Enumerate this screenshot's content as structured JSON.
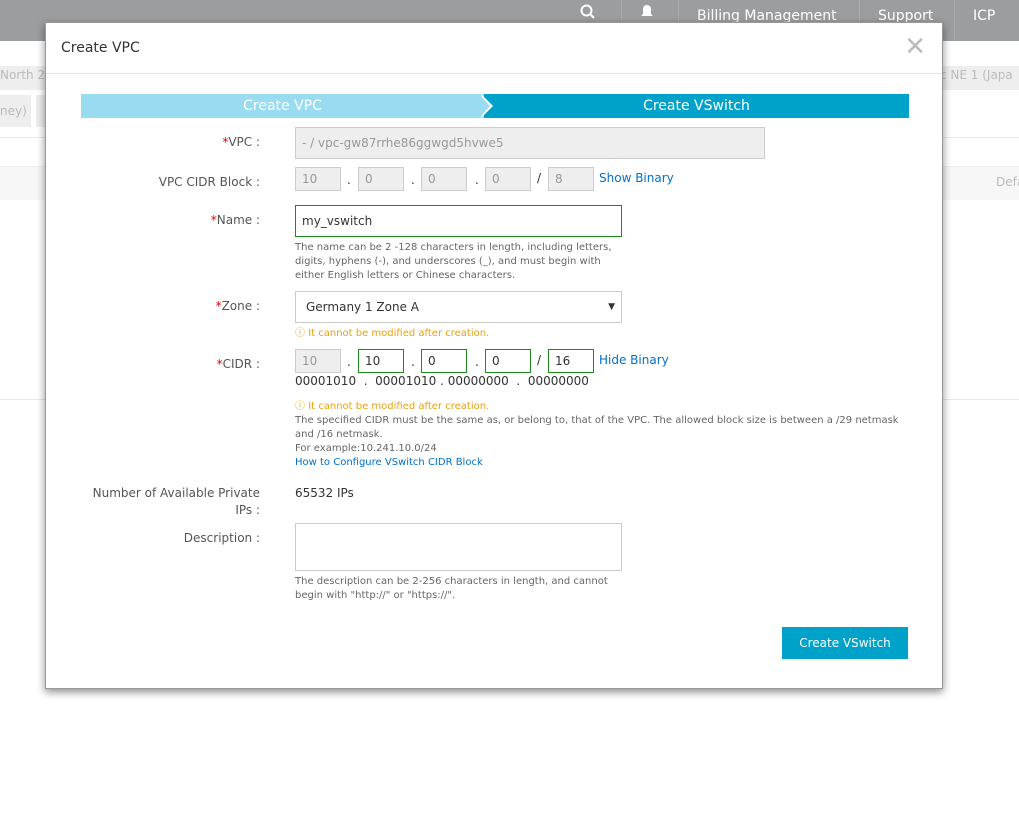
{
  "topbar": {
    "billing": "Billing Management",
    "support": "Support",
    "icp": "ICP"
  },
  "background": {
    "region_left": "North 2 (",
    "region_right": "c NE 1 (Japa",
    "tab_left": "ney)",
    "col_right": "Defa"
  },
  "modal": {
    "title": "Create VPC",
    "steps": [
      "Create VPC",
      "Create VSwitch"
    ],
    "vpc": {
      "label": "VPC :",
      "value": "- / vpc-gw87rrhe86ggwgd5hvwe5"
    },
    "vpc_cidr": {
      "label": "VPC CIDR Block :",
      "octets": [
        "10",
        "0",
        "0",
        "0"
      ],
      "mask": "8",
      "toggle": "Show Binary"
    },
    "name": {
      "label": "Name :",
      "value": "my_vswitch",
      "help": "The name can be 2 -128 characters in length, including letters, digits, hyphens (-), and underscores (_), and must begin with either English letters or Chinese characters."
    },
    "zone": {
      "label": "Zone :",
      "value": "Germany 1 Zone A",
      "warning": "It cannot be modified after creation."
    },
    "cidr": {
      "label": "CIDR :",
      "octets": [
        "10",
        "10",
        "0",
        "0"
      ],
      "mask": "16",
      "toggle": "Hide Binary",
      "binary": [
        "00001010",
        "00001010",
        "00000000",
        "00000000"
      ],
      "warning": "It cannot be modified after creation.",
      "help1": "The specified CIDR must be the same as, or belong to, that of the VPC. The allowed block size is between a /29 netmask and /16 netmask.",
      "help2": "For example:10.241.10.0/24",
      "link": "How to Configure VSwitch CIDR Block"
    },
    "ips": {
      "label": "Number of Available Private IPs :",
      "value": "65532 IPs"
    },
    "description": {
      "label": "Description :",
      "value": "",
      "help": "The description can be 2-256 characters in length, and cannot begin with \"http://\" or \"https://\"."
    },
    "submit": "Create VSwitch"
  }
}
